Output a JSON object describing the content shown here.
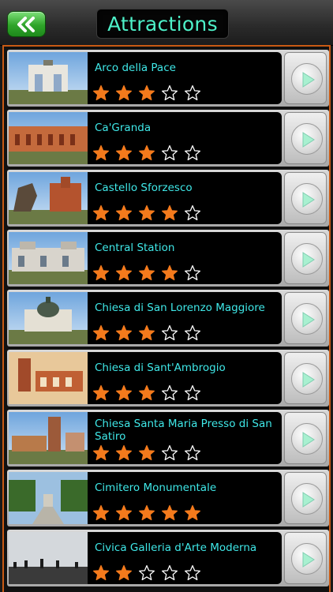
{
  "header": {
    "title": "Attractions",
    "back_icon": "double-chevron-left-icon",
    "accent": "#4df0c8"
  },
  "attractions": [
    {
      "name": "Arco della Pace",
      "rating": 3
    },
    {
      "name": "Ca'Granda",
      "rating": 3
    },
    {
      "name": "Castello Sforzesco",
      "rating": 4
    },
    {
      "name": "Central Station",
      "rating": 4
    },
    {
      "name": "Chiesa di San Lorenzo Maggiore",
      "rating": 3
    },
    {
      "name": "Chiesa di Sant'Ambrogio",
      "rating": 3
    },
    {
      "name": "Chiesa Santa Maria Presso di San Satiro",
      "rating": 3
    },
    {
      "name": "Cimitero Monumentale",
      "rating": 5
    },
    {
      "name": "Civica Galleria d'Arte Moderna",
      "rating": 2
    }
  ],
  "rating_max": 5,
  "colors": {
    "star_filled": "#f47a1c",
    "star_empty": "#ffffff",
    "name_text": "#3fe8e8",
    "frame_border": "#c85a14"
  }
}
